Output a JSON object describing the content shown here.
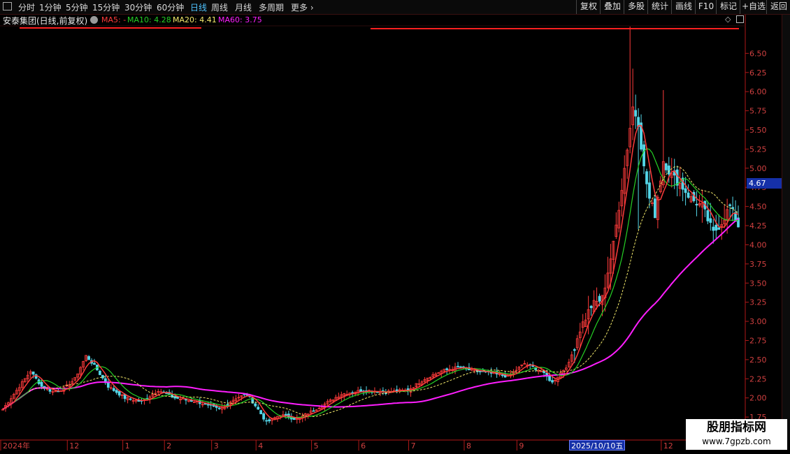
{
  "toolbar": {
    "left_items": [
      "分时",
      "1分钟",
      "5分钟",
      "15分钟",
      "30分钟",
      "60分钟",
      "日线",
      "周线",
      "月线",
      "多周期",
      "更多"
    ],
    "active_item": "日线",
    "right_items": [
      "复权",
      "叠加",
      "多股",
      "统计",
      "画线",
      "F10",
      "标记",
      "+自选",
      "返回"
    ]
  },
  "legend": {
    "title": "安泰集团(日线,前复权)",
    "ma5": "MA5: -",
    "ma10": "MA10: 4.28",
    "ma20": "MA20: 4.41",
    "ma60": "MA60: 3.75"
  },
  "colors": {
    "bg": "#000000",
    "axis": "#b01818",
    "up": "#ff3b3b",
    "down": "#54d6e8",
    "ma5": "#ff3b3b",
    "ma10": "#25d025",
    "ma20": "#f2e86a",
    "ma60": "#ff1eff",
    "price_tag_bg": "#1530a8"
  },
  "price_tag": "4.67",
  "date_tag": "2025/10/10五",
  "watermark": {
    "line1": "股朋指标网",
    "line2": "www.7gpzb.com"
  },
  "chart_data": {
    "type": "candlestick",
    "title": "安泰集团(日线,前复权)",
    "y_ticks": [
      6.5,
      6.25,
      6.0,
      5.75,
      5.5,
      5.25,
      5.0,
      4.75,
      4.5,
      4.25,
      4.0,
      3.75,
      3.5,
      3.25,
      3.0,
      2.75,
      2.5,
      2.25,
      2.0,
      1.75,
      1.5
    ],
    "ylim": [
      1.45,
      6.85
    ],
    "x_labels": [
      {
        "label": "2024年",
        "day": 0
      },
      {
        "label": "12",
        "day": 24
      },
      {
        "label": "1",
        "day": 44
      },
      {
        "label": "2",
        "day": 59
      },
      {
        "label": "3",
        "day": 76
      },
      {
        "label": "4",
        "day": 92
      },
      {
        "label": "5",
        "day": 112
      },
      {
        "label": "6",
        "day": 129
      },
      {
        "label": "7",
        "day": 147
      },
      {
        "label": "8",
        "day": 167
      },
      {
        "label": "9",
        "day": 186
      },
      {
        "label": "12",
        "day": 238
      }
    ],
    "n_days": 266,
    "keypoints": [
      [
        0,
        1.85
      ],
      [
        6,
        2.15
      ],
      [
        10,
        2.35
      ],
      [
        14,
        2.15
      ],
      [
        18,
        2.08
      ],
      [
        22,
        2.12
      ],
      [
        26,
        2.25
      ],
      [
        30,
        2.55
      ],
      [
        33,
        2.42
      ],
      [
        38,
        2.15
      ],
      [
        44,
        2.0
      ],
      [
        50,
        1.95
      ],
      [
        56,
        2.1
      ],
      [
        62,
        2.0
      ],
      [
        70,
        1.95
      ],
      [
        78,
        1.85
      ],
      [
        84,
        2.0
      ],
      [
        88,
        2.05
      ],
      [
        92,
        1.85
      ],
      [
        95,
        1.68
      ],
      [
        100,
        1.78
      ],
      [
        106,
        1.72
      ],
      [
        110,
        1.8
      ],
      [
        116,
        1.92
      ],
      [
        122,
        2.05
      ],
      [
        130,
        2.1
      ],
      [
        138,
        2.08
      ],
      [
        146,
        2.1
      ],
      [
        152,
        2.25
      ],
      [
        158,
        2.35
      ],
      [
        164,
        2.4
      ],
      [
        170,
        2.35
      ],
      [
        176,
        2.32
      ],
      [
        182,
        2.28
      ],
      [
        188,
        2.45
      ],
      [
        194,
        2.35
      ],
      [
        198,
        2.2
      ],
      [
        204,
        2.45
      ],
      [
        208,
        2.9
      ],
      [
        212,
        3.2
      ],
      [
        216,
        3.3
      ],
      [
        220,
        4.0
      ],
      [
        224,
        5.0
      ],
      [
        227,
        5.8
      ],
      [
        229,
        5.6
      ],
      [
        231,
        5.0
      ],
      [
        233,
        4.6
      ],
      [
        235,
        4.4
      ],
      [
        238,
        5.1
      ],
      [
        241,
        4.9
      ],
      [
        244,
        4.8
      ],
      [
        248,
        4.6
      ],
      [
        252,
        4.5
      ],
      [
        256,
        4.15
      ],
      [
        259,
        4.3
      ],
      [
        262,
        4.5
      ],
      [
        265,
        4.25
      ]
    ],
    "spikes": [
      [
        226,
        6.85
      ],
      [
        227,
        6.3
      ],
      [
        238,
        6.02
      ],
      [
        229,
        4.2
      ]
    ],
    "last_values": {
      "ma10": 4.28,
      "ma20": 4.41,
      "ma60": 3.75
    }
  }
}
